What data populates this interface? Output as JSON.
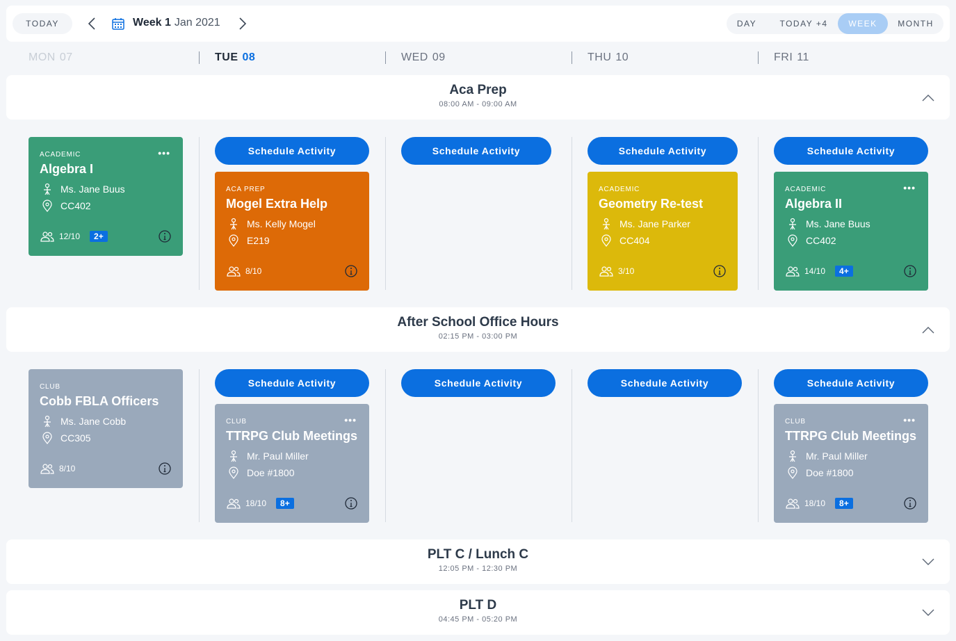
{
  "toolbar": {
    "today_label": "TODAY",
    "week_bold": "Week 1",
    "week_month": "Jan 2021",
    "views": [
      {
        "label": "DAY"
      },
      {
        "label": "TODAY +4"
      },
      {
        "label": "WEEK"
      },
      {
        "label": "MONTH"
      }
    ],
    "active_view": "WEEK"
  },
  "days": [
    {
      "dow": "MON",
      "num": "07"
    },
    {
      "dow": "TUE",
      "num": "08"
    },
    {
      "dow": "WED",
      "num": "09"
    },
    {
      "dow": "THU",
      "num": "10"
    },
    {
      "dow": "FRI",
      "num": "11"
    }
  ],
  "schedule_label": "Schedule Activity",
  "periods": [
    {
      "title": "Aca Prep",
      "time": "08:00 AM - 09:00 AM",
      "expanded": true,
      "cards": [
        {
          "category": "ACADEMIC",
          "title": "Algebra I",
          "teacher": "Ms. Jane Buus",
          "room": "CC402",
          "count": "12/10",
          "badge": "2+",
          "color": "#3a9d78"
        },
        {
          "category": "ACA PREP",
          "title": "Mogel Extra Help",
          "teacher": "Ms. Kelly Mogel",
          "room": "E219",
          "count": "8/10",
          "color": "#dd6a07"
        },
        {
          "category": "ACADEMIC",
          "title": "Geometry Re-test",
          "teacher": "Ms. Jane Parker",
          "room": "CC404",
          "count": "3/10",
          "color": "#dcb90b"
        },
        {
          "category": "ACADEMIC",
          "title": "Algebra II",
          "teacher": "Ms. Jane Buus",
          "room": "CC402",
          "count": "14/10",
          "badge": "4+",
          "color": "#3a9d78"
        }
      ]
    },
    {
      "title": "After School Office Hours",
      "time": "02:15 PM - 03:00 PM",
      "expanded": true,
      "cards": [
        {
          "category": "CLUB",
          "title": "Cobb FBLA Officers",
          "teacher": "Ms. Jane Cobb",
          "room": "CC305",
          "count": "8/10",
          "color": "#9aa9bb"
        },
        {
          "category": "CLUB",
          "title": "TTRPG Club Meetings",
          "teacher": "Mr. Paul Miller",
          "room": "Doe #1800",
          "count": "18/10",
          "badge": "8+",
          "color": "#9aa9bb"
        },
        {
          "category": "CLUB",
          "title": "TTRPG Club Meetings",
          "teacher": "Mr. Paul Miller",
          "room": "Doe #1800",
          "count": "18/10",
          "badge": "8+",
          "color": "#9aa9bb"
        }
      ]
    },
    {
      "title": "PLT C / Lunch C",
      "time": "12:05 PM - 12:30 PM",
      "expanded": false
    },
    {
      "title": "PLT D",
      "time": "04:45 PM - 05:20 PM",
      "expanded": false
    }
  ],
  "colors": {
    "accent": "#0b6fe0",
    "active_view_bg": "#a9cdf5"
  }
}
